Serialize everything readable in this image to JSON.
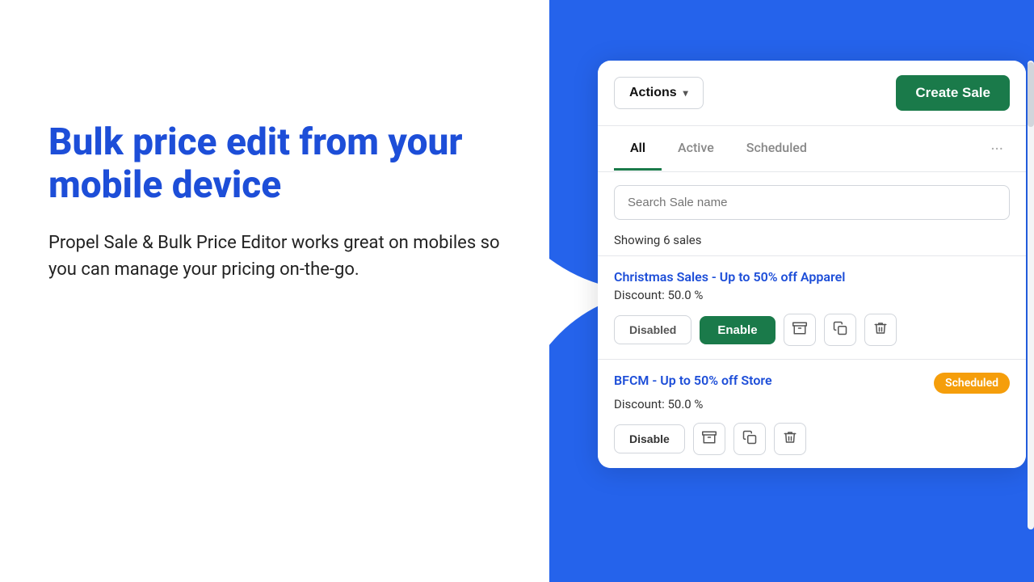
{
  "background": {
    "blue_color": "#2563eb"
  },
  "left": {
    "headline": "Bulk price edit from your mobile device",
    "subtext": "Propel Sale & Bulk Price Editor works great on mobiles so you can manage your pricing on-the-go."
  },
  "toolbar": {
    "actions_label": "Actions",
    "create_sale_label": "Create Sale"
  },
  "tabs": {
    "all_label": "All",
    "active_label": "Active",
    "scheduled_label": "Scheduled",
    "more_icon": "···"
  },
  "search": {
    "placeholder": "Search Sale name"
  },
  "count": {
    "text": "Showing 6 sales"
  },
  "sales": [
    {
      "name": "Christmas Sales - Up to 50% off Apparel",
      "discount": "Discount: 50.0 %",
      "status": "disabled",
      "badge": null,
      "btn_left_label": "Disabled",
      "btn_right_label": "Enable"
    },
    {
      "name": "BFCM - Up to 50% off Store",
      "discount": "Discount: 50.0 %",
      "status": "scheduled",
      "badge": "Scheduled",
      "btn_left_label": "Disable",
      "btn_right_label": null
    }
  ],
  "icons": {
    "archive": "🗃",
    "copy": "⧉",
    "trash": "🗑",
    "chevron_down": "▾"
  }
}
